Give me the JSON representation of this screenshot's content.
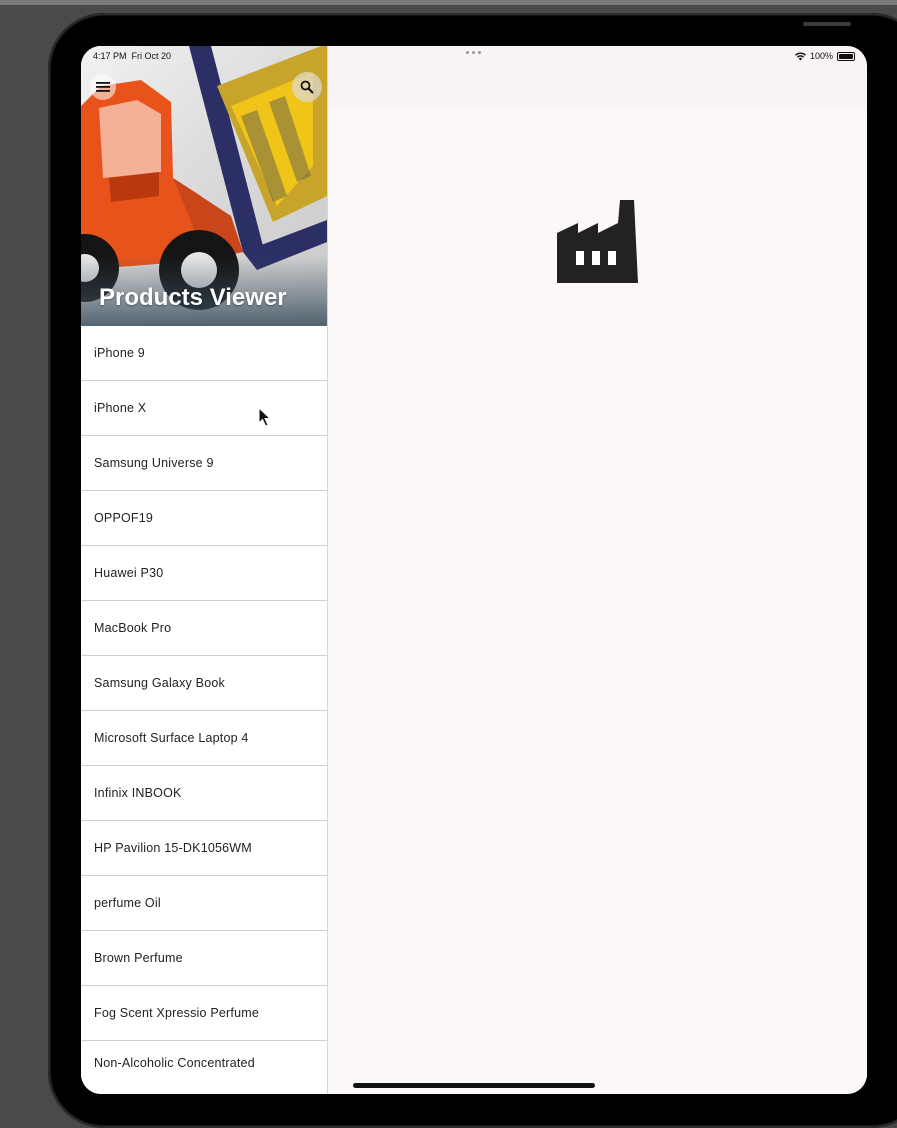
{
  "status_bar": {
    "time": "4:17 PM",
    "date": "Fri Oct 20",
    "battery": "100%",
    "icons": [
      "wifi-icon",
      "battery-icon"
    ]
  },
  "drawer": {
    "title": "Products Viewer",
    "menu_icon": "menu-icon",
    "search_icon": "search-icon",
    "items": [
      {
        "label": "iPhone 9"
      },
      {
        "label": "iPhone X"
      },
      {
        "label": "Samsung Universe 9"
      },
      {
        "label": "OPPOF19"
      },
      {
        "label": "Huawei P30"
      },
      {
        "label": "MacBook Pro"
      },
      {
        "label": "Samsung Galaxy Book"
      },
      {
        "label": "Microsoft Surface Laptop 4"
      },
      {
        "label": "Infinix INBOOK"
      },
      {
        "label": "HP Pavilion 15-DK1056WM"
      },
      {
        "label": "perfume Oil"
      },
      {
        "label": "Brown Perfume"
      },
      {
        "label": "Fog Scent Xpressio Perfume"
      },
      {
        "label": "Non-Alcoholic Concentrated"
      }
    ]
  },
  "main": {
    "placeholder_icon": "factory-icon"
  },
  "colors": {
    "screen_bg": "#fdf8f8",
    "appbar_bg": "#f8f4f5",
    "icon": "#222222",
    "forklift_orange": "#e8531c",
    "crate_yellow": "#f0c419",
    "header_title": "#ffffff"
  }
}
